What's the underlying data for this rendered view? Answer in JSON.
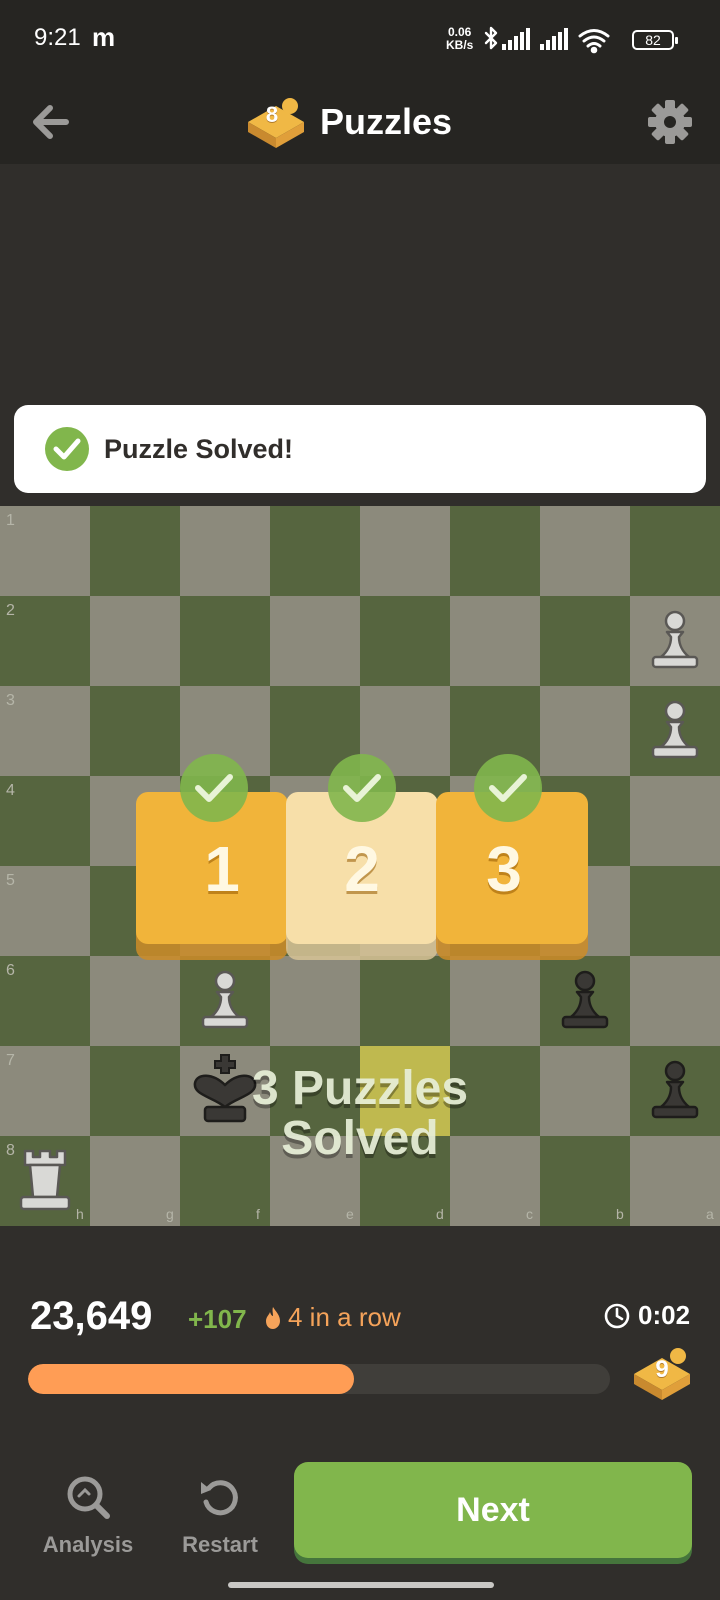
{
  "status_bar": {
    "time": "9:21",
    "app_glyph": "m",
    "net_speed_value": "0.06",
    "net_speed_unit": "KB/s",
    "battery": "82",
    "icons": [
      "bluetooth-icon",
      "signal-icon",
      "signal-icon",
      "wifi-icon"
    ]
  },
  "header": {
    "title": "Puzzles",
    "badge_number": "8",
    "back_icon": "arrow-left-icon",
    "settings_icon": "gear-icon"
  },
  "toast": {
    "message": "Puzzle Solved!",
    "icon": "check-circle-icon",
    "accent": "#81b64c"
  },
  "board": {
    "light_color": "#8c8a7c",
    "dark_color": "#56653f",
    "highlight_color": "#bfb94f",
    "rank_labels": [
      "1",
      "2",
      "3",
      "4",
      "5",
      "6",
      "7",
      "8"
    ],
    "file_labels": [
      "h",
      "g",
      "f",
      "e",
      "d",
      "c",
      "b",
      "a"
    ],
    "pieces": [
      {
        "type": "pawn",
        "color": "white",
        "square": "a2"
      },
      {
        "type": "pawn",
        "color": "white",
        "square": "a3"
      },
      {
        "type": "pawn",
        "color": "white",
        "square": "f6"
      },
      {
        "type": "pawn",
        "color": "black",
        "square": "b6"
      },
      {
        "type": "pawn",
        "color": "black",
        "square": "a7"
      },
      {
        "type": "king",
        "color": "black",
        "square": "f7"
      },
      {
        "type": "rook",
        "color": "white",
        "square": "h8"
      }
    ],
    "overlay_line_1": "3 Puzzles",
    "overlay_line_2": "Solved"
  },
  "streak_badges": [
    {
      "number": "1",
      "solved": true
    },
    {
      "number": "2",
      "solved": true
    },
    {
      "number": "3",
      "solved": true
    }
  ],
  "stats": {
    "rating": "23,649",
    "rating_delta": "+107",
    "streak": "4 in a row",
    "timer": "0:02",
    "progress_fraction": 0.56,
    "next_badge_number": "9",
    "accent_orange": "#ff9d55",
    "accent_green": "#81b64c"
  },
  "actions": {
    "analysis_label": "Analysis",
    "restart_label": "Restart",
    "next_label": "Next"
  }
}
